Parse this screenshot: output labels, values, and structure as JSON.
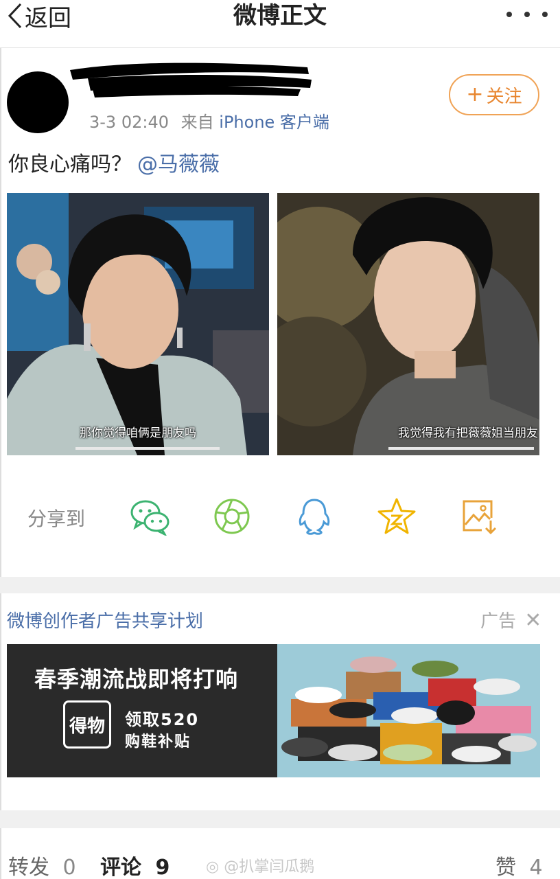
{
  "nav": {
    "back_label": "返回",
    "title": "微博正文"
  },
  "post": {
    "meta_time": "3-3 02:40",
    "meta_source": "来自",
    "meta_client": "iPhone 客户端",
    "follow_label": "关注",
    "text": "你良心痛吗？",
    "mention": "@马薇薇"
  },
  "photos": [
    {
      "caption": "那你觉得咱俩是朋友吗"
    },
    {
      "caption": "我觉得我有把薇薇姐当朋友"
    }
  ],
  "share": {
    "label": "分享到",
    "icons": [
      "wechat-icon",
      "moments-icon",
      "qq-icon",
      "qzone-icon",
      "save-image-icon"
    ],
    "colors": {
      "wechat": "#3cb371",
      "moments": "#7ec850",
      "qq": "#4a9ad6",
      "qzone": "#f0b400",
      "save": "#e8a33a"
    }
  },
  "ad": {
    "program": "微博创作者广告共享计划",
    "tag": "广告",
    "headline": "春季潮流战即将打响",
    "logo_text": "得物",
    "offer_line1": "领取520",
    "offer_line2": "购鞋补贴"
  },
  "actions": {
    "repost_label": "转发",
    "repost_count": "0",
    "comment_label": "评论",
    "comment_count": "9",
    "like_label": "赞",
    "like_count": "4"
  },
  "watermark": "@扒掌闫瓜鹅",
  "colors": {
    "link": "#4a6ea8",
    "follow": "#e8862f",
    "separator": "#f0f0f0"
  }
}
